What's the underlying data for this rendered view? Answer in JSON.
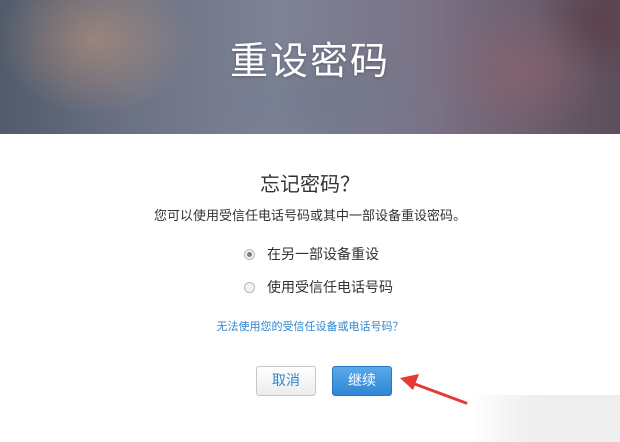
{
  "header": {
    "title": "重设密码"
  },
  "main": {
    "question": "忘记密码？",
    "description": "您可以使用受信任电话号码或其中一部设备重设密码。",
    "options": [
      {
        "label": "在另一部设备重设",
        "checked": true
      },
      {
        "label": "使用受信任电话号码",
        "checked": false
      }
    ],
    "help_link": "无法使用您的受信任设备或电话号码？"
  },
  "actions": {
    "cancel_label": "取消",
    "continue_label": "继续"
  },
  "colors": {
    "link": "#2f86d0",
    "primary_button": "#3a8fdc",
    "annotation_arrow": "#e53935"
  }
}
